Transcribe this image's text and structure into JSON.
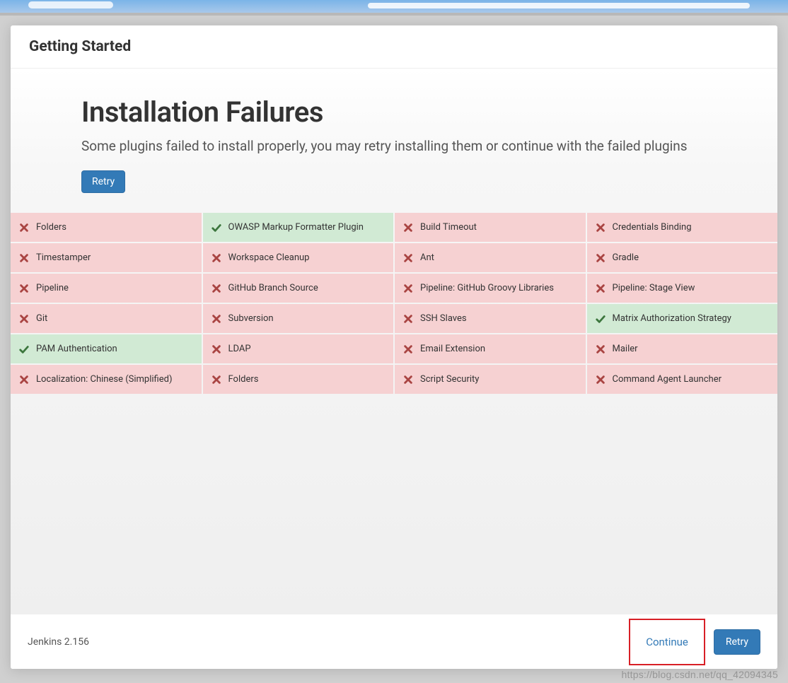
{
  "header": {
    "title": "Getting Started"
  },
  "main": {
    "title": "Installation Failures",
    "subtitle": "Some plugins failed to install properly, you may retry installing them or continue with the failed plugins",
    "retry_label": "Retry"
  },
  "plugins": [
    {
      "name": "Folders",
      "status": "fail"
    },
    {
      "name": "OWASP Markup Formatter Plugin",
      "status": "ok"
    },
    {
      "name": "Build Timeout",
      "status": "fail"
    },
    {
      "name": "Credentials Binding",
      "status": "fail"
    },
    {
      "name": "Timestamper",
      "status": "fail"
    },
    {
      "name": "Workspace Cleanup",
      "status": "fail"
    },
    {
      "name": "Ant",
      "status": "fail"
    },
    {
      "name": "Gradle",
      "status": "fail"
    },
    {
      "name": "Pipeline",
      "status": "fail"
    },
    {
      "name": "GitHub Branch Source",
      "status": "fail"
    },
    {
      "name": "Pipeline: GitHub Groovy Libraries",
      "status": "fail"
    },
    {
      "name": "Pipeline: Stage View",
      "status": "fail"
    },
    {
      "name": "Git",
      "status": "fail"
    },
    {
      "name": "Subversion",
      "status": "fail"
    },
    {
      "name": "SSH Slaves",
      "status": "fail"
    },
    {
      "name": "Matrix Authorization Strategy",
      "status": "ok"
    },
    {
      "name": "PAM Authentication",
      "status": "ok"
    },
    {
      "name": "LDAP",
      "status": "fail"
    },
    {
      "name": "Email Extension",
      "status": "fail"
    },
    {
      "name": "Mailer",
      "status": "fail"
    },
    {
      "name": "Localization: Chinese (Simplified)",
      "status": "fail"
    },
    {
      "name": "Folders",
      "status": "fail"
    },
    {
      "name": "Script Security",
      "status": "fail"
    },
    {
      "name": "Command Agent Launcher",
      "status": "fail"
    }
  ],
  "footer": {
    "version": "Jenkins 2.156",
    "continue_label": "Continue",
    "retry_label": "Retry"
  },
  "watermark": "https://blog.csdn.net/qq_42094345"
}
